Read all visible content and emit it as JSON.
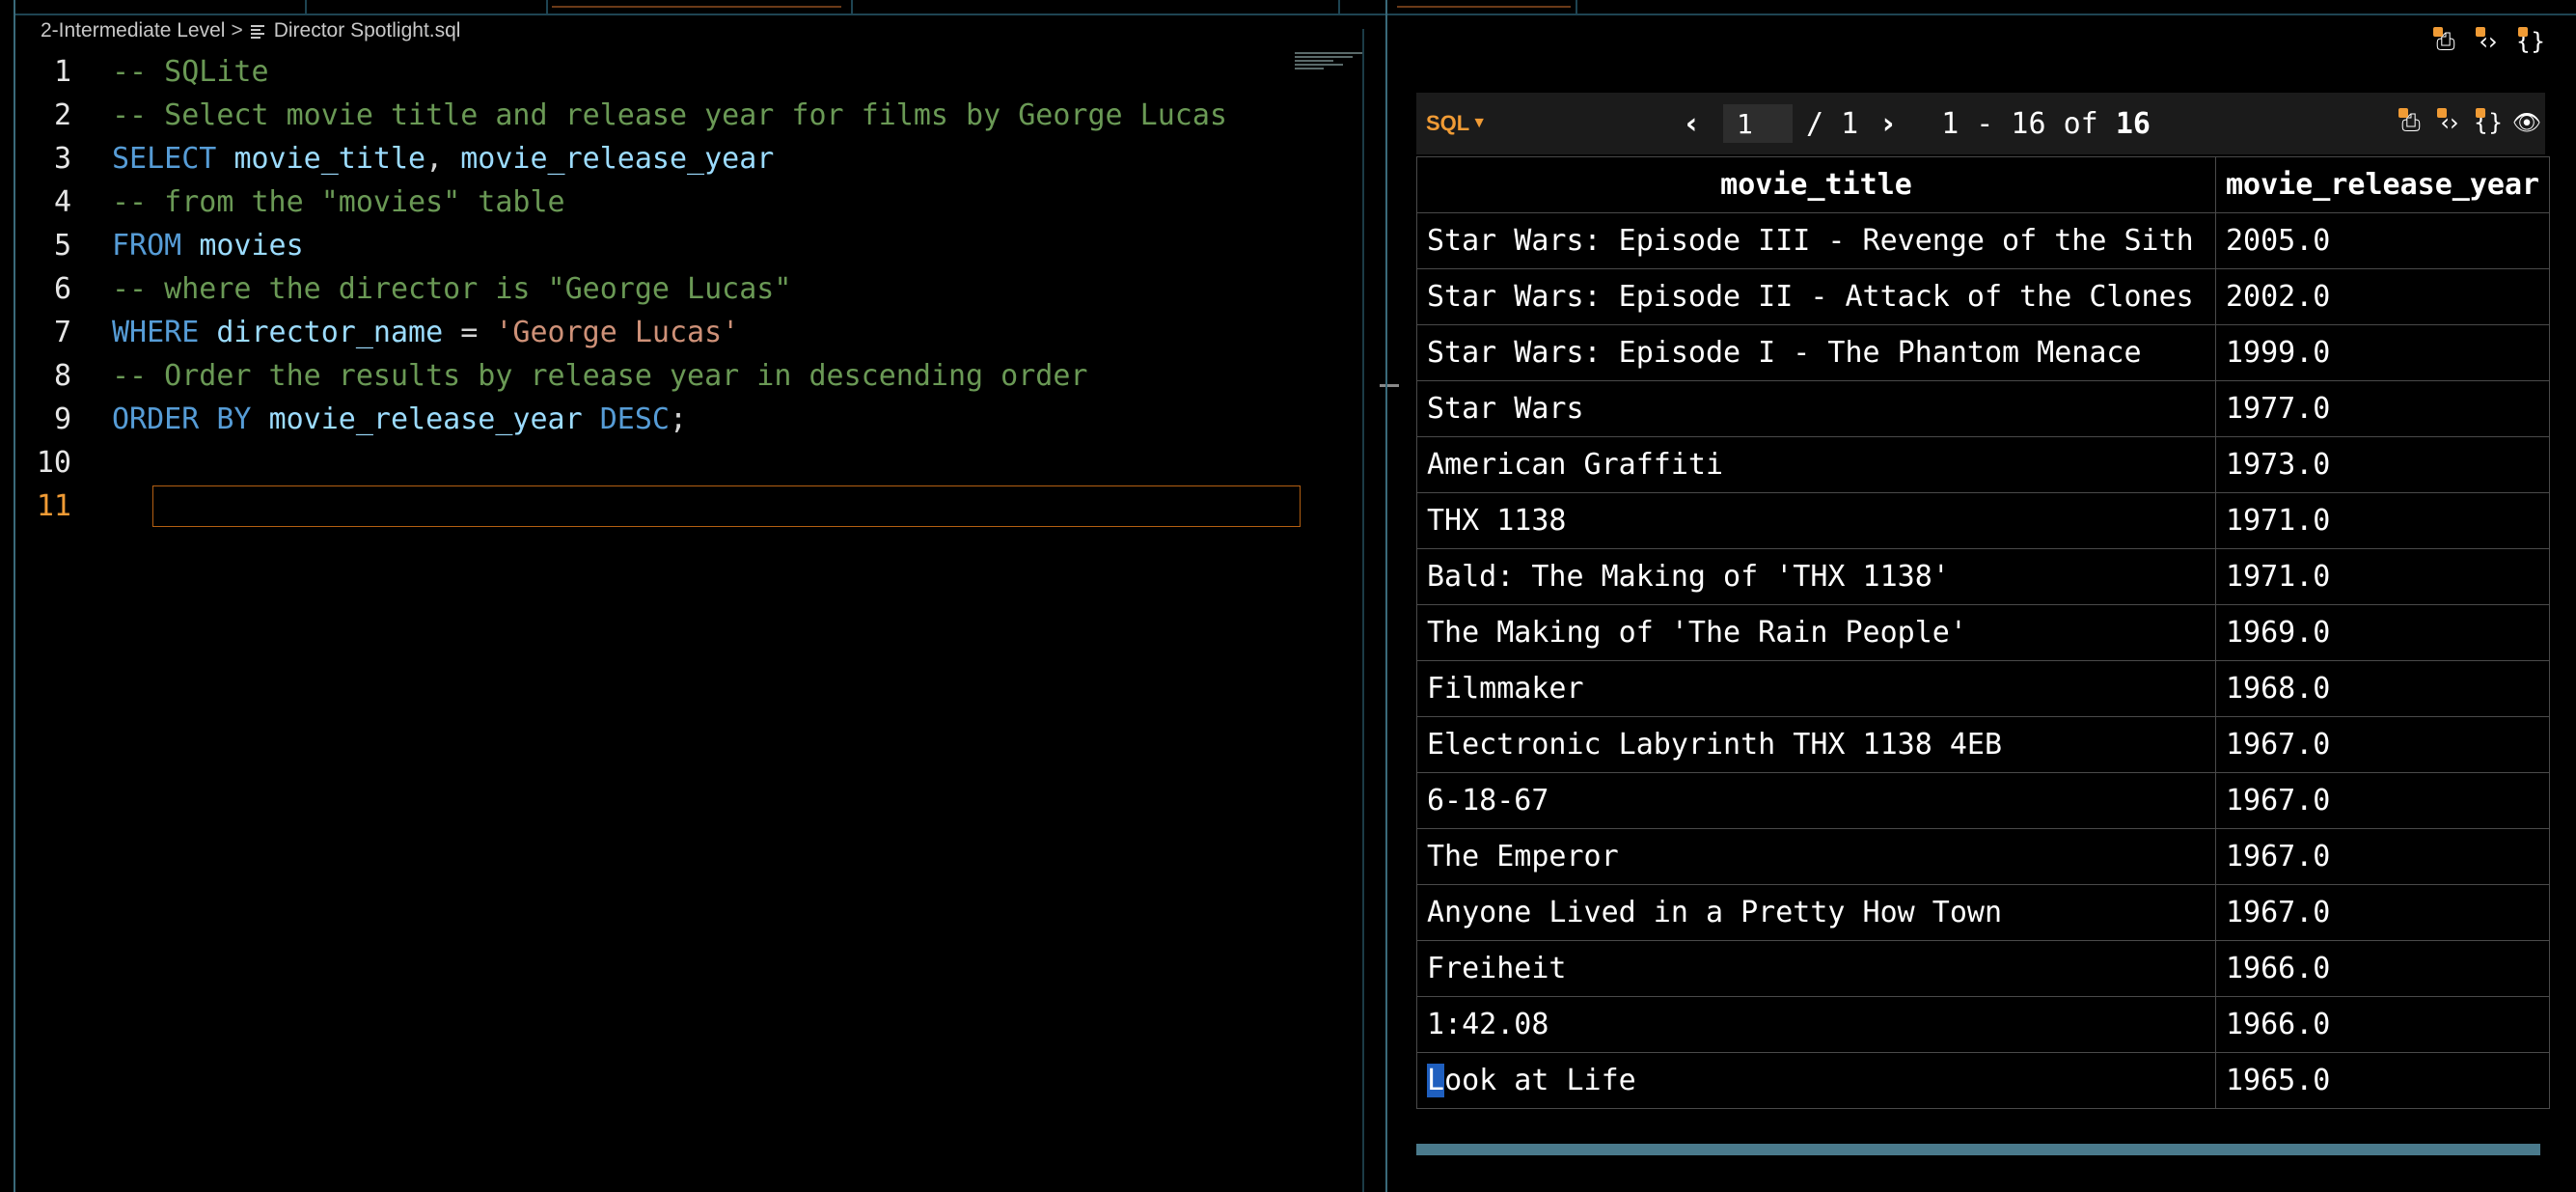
{
  "editor": {
    "breadcrumb_folder": "2-Intermediate Level",
    "breadcrumb_separator": ">",
    "breadcrumb_file": "Director Spotlight.sql",
    "current_line": 11,
    "lines": [
      {
        "n": 1,
        "tokens": [
          [
            "comment",
            "-- SQLite"
          ]
        ]
      },
      {
        "n": 2,
        "tokens": [
          [
            "comment",
            "-- Select movie title and release year for films by George Lucas"
          ]
        ]
      },
      {
        "n": 3,
        "tokens": [
          [
            "kw",
            "SELECT "
          ],
          [
            "id",
            "movie_title"
          ],
          [
            "punc",
            ", "
          ],
          [
            "id",
            "movie_release_year"
          ]
        ]
      },
      {
        "n": 4,
        "tokens": [
          [
            "comment",
            "-- from the \"movies\" table"
          ]
        ]
      },
      {
        "n": 5,
        "tokens": [
          [
            "kw",
            "FROM "
          ],
          [
            "id",
            "movies"
          ]
        ]
      },
      {
        "n": 6,
        "tokens": [
          [
            "comment",
            "-- where the director is \"George Lucas\""
          ]
        ]
      },
      {
        "n": 7,
        "tokens": [
          [
            "kw",
            "WHERE "
          ],
          [
            "id",
            "director_name"
          ],
          [
            "punc",
            " = "
          ],
          [
            "str",
            "'George Lucas'"
          ]
        ]
      },
      {
        "n": 8,
        "tokens": [
          [
            "comment",
            "-- Order the results by release year in descending order"
          ]
        ]
      },
      {
        "n": 9,
        "tokens": [
          [
            "kw",
            "ORDER BY "
          ],
          [
            "id",
            "movie_release_year"
          ],
          [
            "punc",
            " "
          ],
          [
            "kw",
            "DESC"
          ],
          [
            "punc",
            ";"
          ]
        ]
      },
      {
        "n": 10,
        "tokens": []
      },
      {
        "n": 11,
        "tokens": []
      }
    ]
  },
  "results": {
    "sql_badge": "SQL",
    "pager": {
      "prev_icon": "chevron-left-icon",
      "next_icon": "chevron-right-icon",
      "page_value": "1",
      "of_total": "/ 1",
      "range_text": "1 - 16 of ",
      "total_count": "16"
    },
    "columns": [
      "movie_title",
      "movie_release_year"
    ],
    "rows": [
      [
        "Star Wars: Episode III - Revenge of the Sith",
        "2005.0"
      ],
      [
        "Star Wars: Episode II - Attack of the Clones",
        "2002.0"
      ],
      [
        "Star Wars: Episode I - The Phantom Menace",
        "1999.0"
      ],
      [
        "Star Wars",
        "1977.0"
      ],
      [
        "American Graffiti",
        "1973.0"
      ],
      [
        "THX 1138",
        "1971.0"
      ],
      [
        "Bald: The Making of 'THX 1138'",
        "1971.0"
      ],
      [
        "The Making of 'The Rain People'",
        "1969.0"
      ],
      [
        "Filmmaker",
        "1968.0"
      ],
      [
        "Electronic Labyrinth THX 1138 4EB",
        "1967.0"
      ],
      [
        "6-18-67",
        "1967.0"
      ],
      [
        "The Emperor",
        "1967.0"
      ],
      [
        "Anyone Lived in a Pretty How Town",
        "1967.0"
      ],
      [
        "Freiheit",
        "1966.0"
      ],
      [
        "1:42.08",
        "1966.0"
      ],
      [
        "Look at Life",
        "1965.0"
      ]
    ]
  },
  "colors": {
    "accent": "#f09b35",
    "comment": "#6a9955",
    "keyword": "#569cd6",
    "identifier": "#9cdcfe",
    "string": "#ce9178"
  }
}
